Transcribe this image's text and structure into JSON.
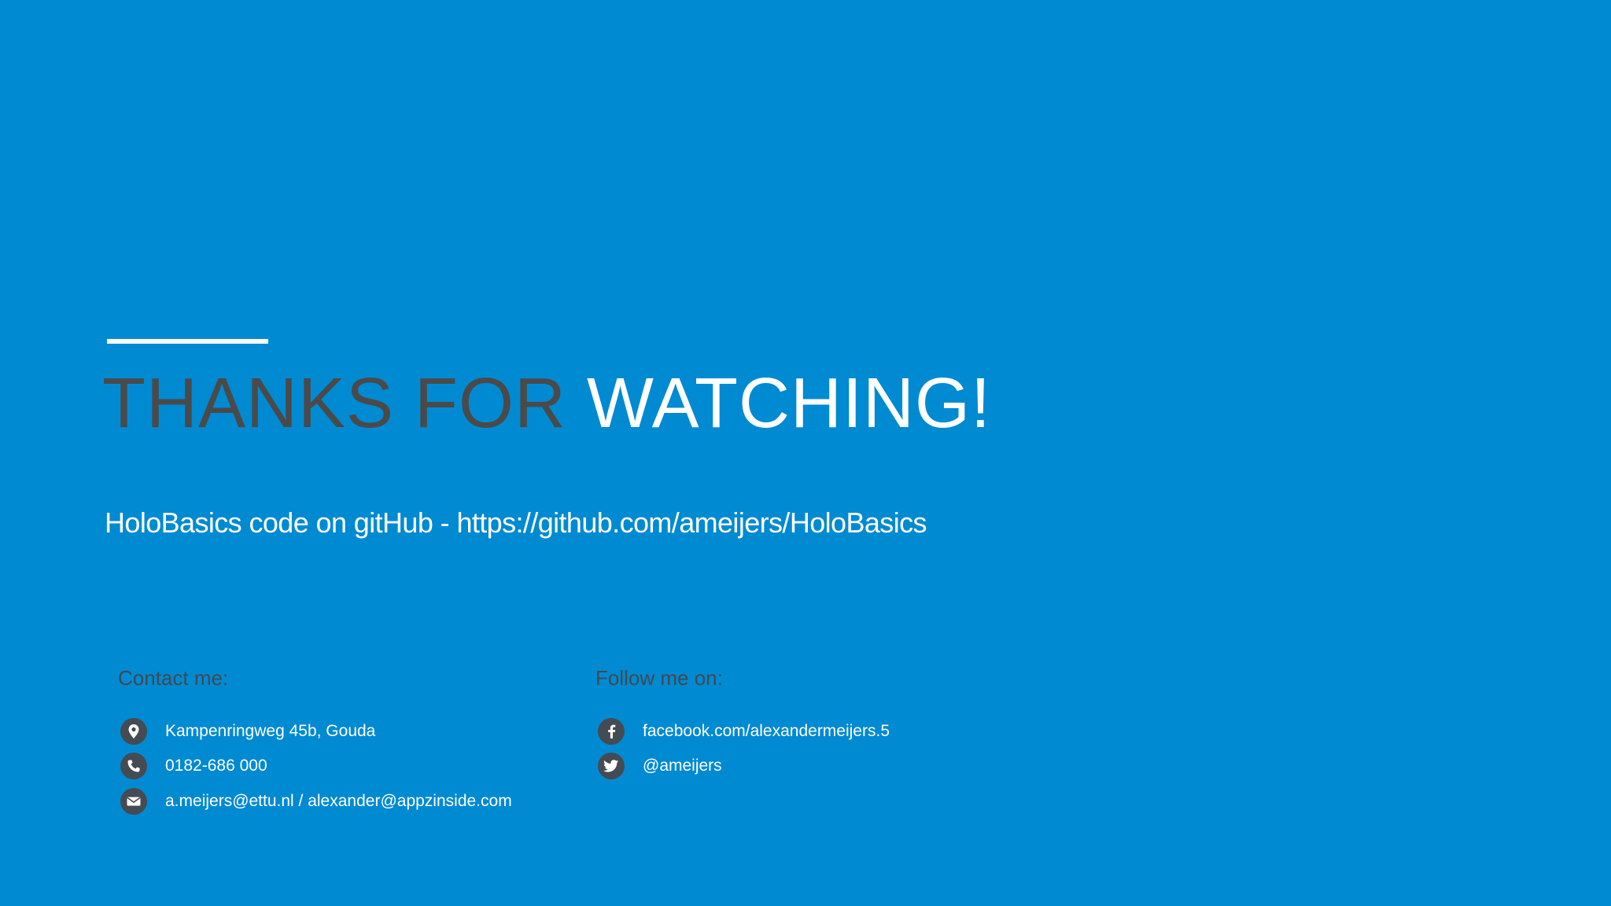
{
  "colors": {
    "background": "#008ad2",
    "title_dark": "#4a4a4a",
    "title_light": "#ffffff",
    "heading": "#3f4a55",
    "icon_circle": "#454b52"
  },
  "title": {
    "part1": "THANKS FOR ",
    "part2": "WATCHING!"
  },
  "subtitle": "HoloBasics code on gitHub - https://github.com/ameijers/HoloBasics",
  "contact": {
    "heading": "Contact me:",
    "items": [
      {
        "icon": "location-pin-icon",
        "text": "Kampenringweg 45b, Gouda"
      },
      {
        "icon": "phone-icon",
        "text": "0182-686 000"
      },
      {
        "icon": "email-icon",
        "text": "a.meijers@ettu.nl / alexander@appzinside.com"
      }
    ]
  },
  "follow": {
    "heading": "Follow me on:",
    "items": [
      {
        "icon": "facebook-icon",
        "text": "facebook.com/alexandermeijers.5"
      },
      {
        "icon": "twitter-icon",
        "text": "@ameijers"
      }
    ]
  }
}
